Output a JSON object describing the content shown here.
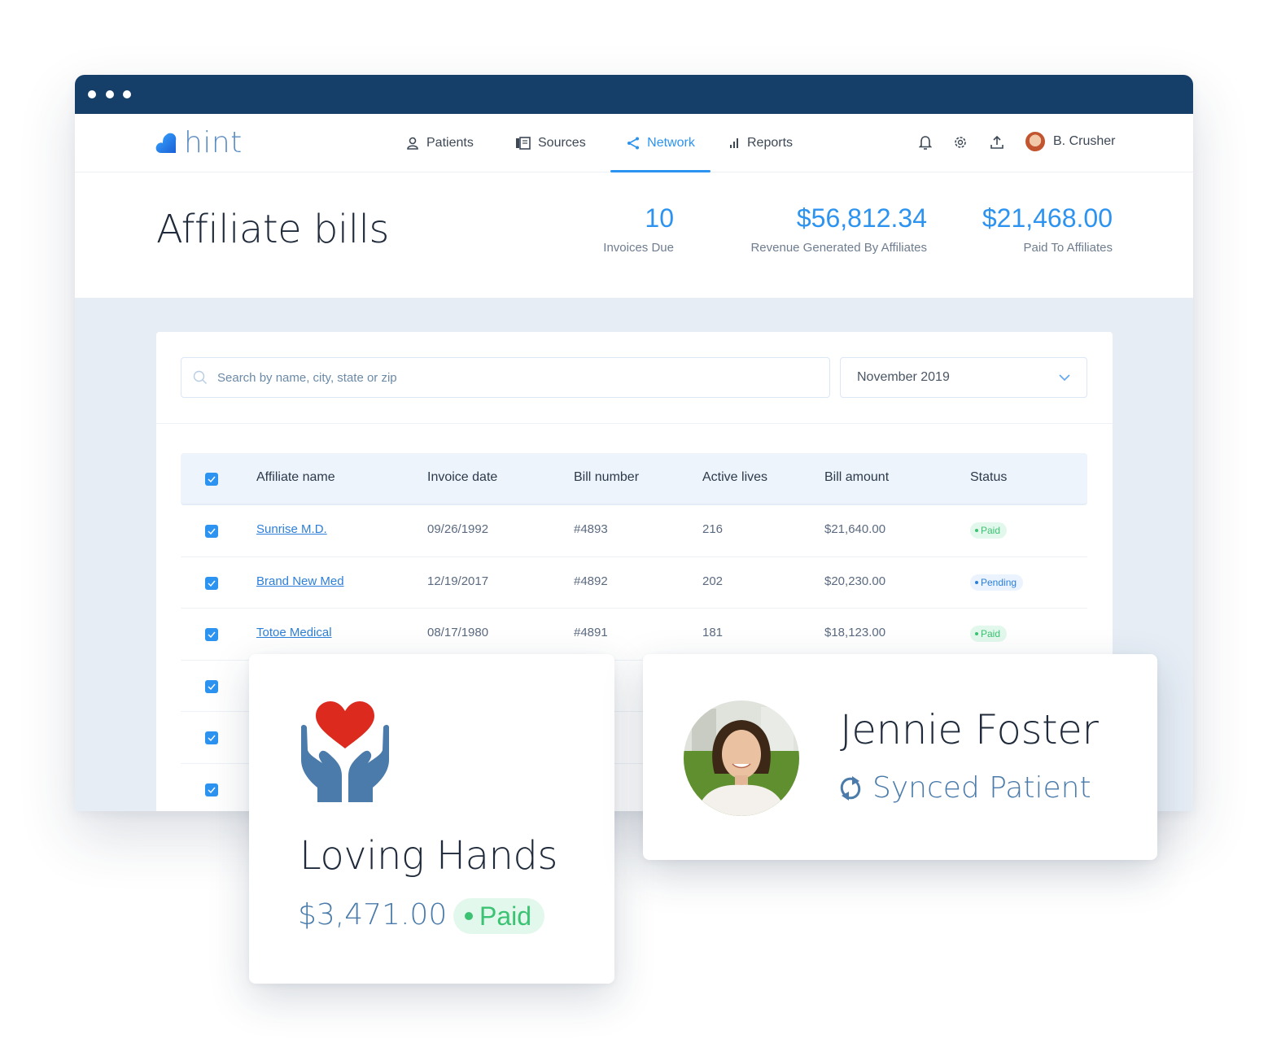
{
  "app": {
    "brand": {
      "name_part1": "hi",
      "name_part2": "nt",
      "full_name": "hint"
    }
  },
  "nav": {
    "items": [
      {
        "label": "Patients",
        "icon": "person-icon",
        "active": false
      },
      {
        "label": "Sources",
        "icon": "book-icon",
        "active": false
      },
      {
        "label": "Network",
        "icon": "share-icon",
        "active": true
      },
      {
        "label": "Reports",
        "icon": "bar-chart-icon",
        "active": false
      }
    ],
    "actions": [
      "bell-icon",
      "gear-icon",
      "upload-icon"
    ],
    "user": {
      "name": "B. Crusher"
    }
  },
  "header": {
    "title": "Affiliate bills",
    "stats": [
      {
        "value": "10",
        "label": "Invoices Due"
      },
      {
        "value": "$56,812.34",
        "label": "Revenue Generated By Affiliates"
      },
      {
        "value": "$21,468.00",
        "label": "Paid To Affiliates"
      }
    ]
  },
  "filters": {
    "search_placeholder": "Search by name, city, state or zip",
    "search_value": "",
    "month_selected": "November 2019"
  },
  "table": {
    "select_all_checked": true,
    "columns": [
      "Affiliate name",
      "Invoice date",
      "Bill number",
      "Active lives",
      "Bill amount",
      "Status"
    ],
    "rows": [
      {
        "checked": true,
        "name": "Sunrise M.D.",
        "date": "09/26/1992",
        "bill": "#4893",
        "lives": "216",
        "amount": "$21,640.00",
        "status": "Paid"
      },
      {
        "checked": true,
        "name": "Brand New Med",
        "date": "12/19/2017",
        "bill": "#4892",
        "lives": "202",
        "amount": "$20,230.00",
        "status": "Pending"
      },
      {
        "checked": true,
        "name": "Totoe Medical",
        "date": "08/17/1980",
        "bill": "#4891",
        "lives": "181",
        "amount": "$18,123.00",
        "status": "Paid"
      },
      {
        "checked": true
      },
      {
        "checked": true
      },
      {
        "checked": true
      }
    ]
  },
  "affiliate_card": {
    "name": "Loving Hands",
    "amount": "$3,471.00",
    "status": "Paid",
    "icon": "heart-hands-icon"
  },
  "patient_card": {
    "name": "Jennie Foster",
    "status": "Synced Patient",
    "icon": "sync-icon"
  },
  "colors": {
    "titlebar": "#153e69",
    "accent": "#2c93f0",
    "paid": "#3cc273",
    "pending": "#2c7fd8",
    "heart": "#dc2a1e",
    "hands": "#4a7bab"
  }
}
